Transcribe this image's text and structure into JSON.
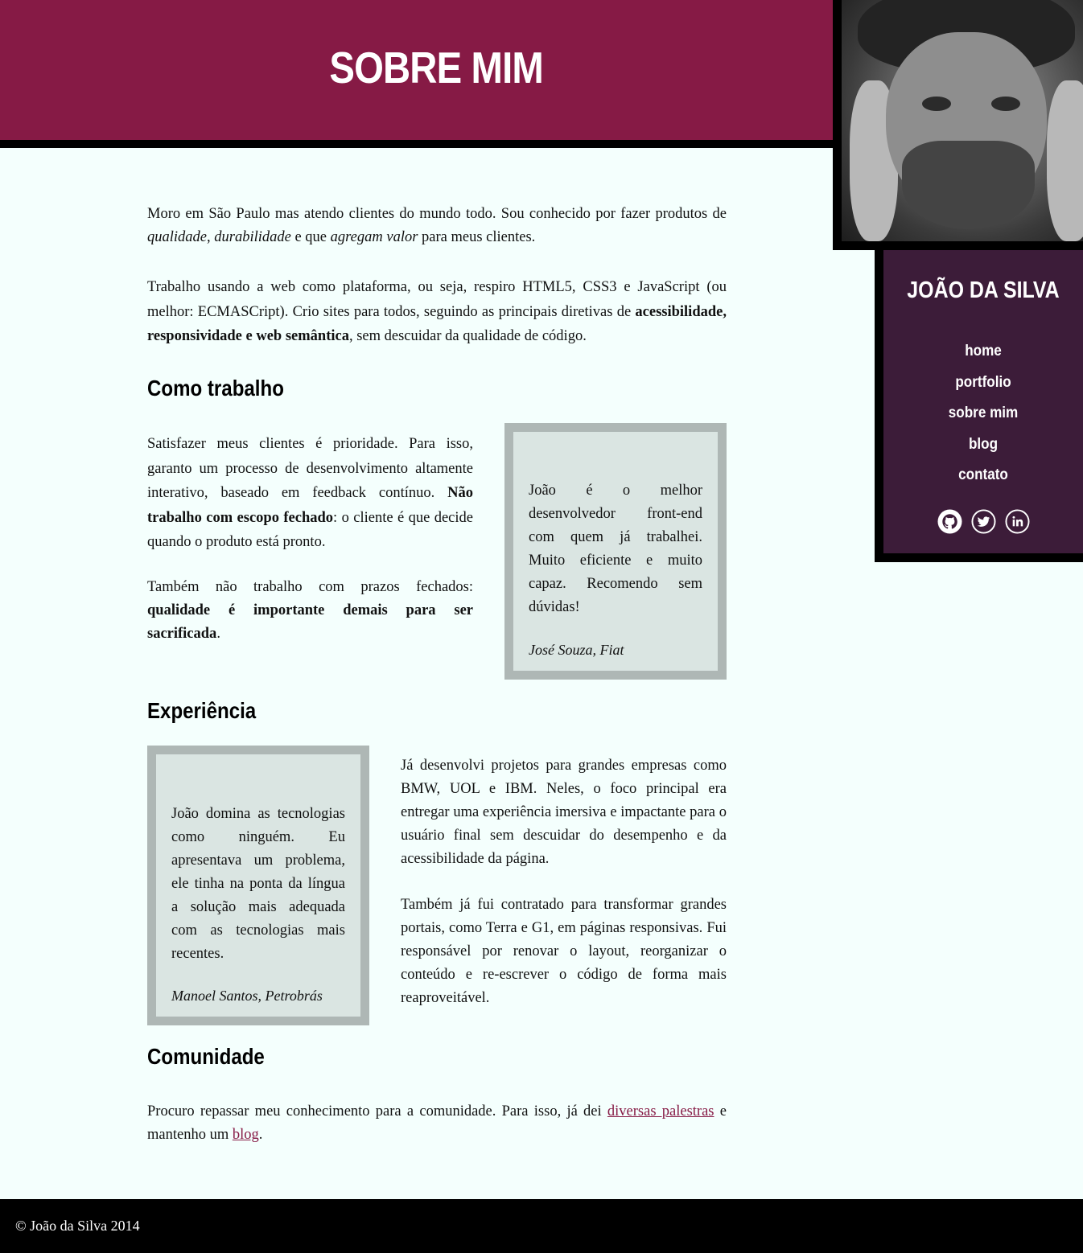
{
  "header": {
    "title": "SOBRE MIM"
  },
  "sidebar": {
    "site_name": "JOÃO DA SILVA",
    "nav": [
      "home",
      "portfolio",
      "sobre mim",
      "blog",
      "contato"
    ],
    "social_icons": [
      "github-icon",
      "twitter-icon",
      "linkedin-icon"
    ]
  },
  "intro": {
    "p1_a": "Moro em São Paulo mas atendo clientes do mundo todo. Sou conhecido por fazer produtos de ",
    "p1_em1": "qualidade",
    "p1_sep1": ", ",
    "p1_em2": "durabilidade",
    "p1_mid": " e que ",
    "p1_em3": "agregam valor",
    "p1_end": " para meus clientes.",
    "p2_a": "Trabalho usando a web como plataforma, ou seja, respiro HTML5, CSS3 e JavaScript (ou melhor: ECMASCript). Crio sites para todos, seguindo as principais diretivas de ",
    "p2_strong": "acessibilidade, responsividade e web semântica",
    "p2_end": ", sem descuidar da qualidade de código."
  },
  "como_trabalho": {
    "heading": "Como trabalho",
    "p1_a": "Satisfazer meus clientes é prioridade. Para isso, garanto um processo de desenvolvimento altamente interativo, baseado em feedback contínuo. ",
    "p1_strong": "Não trabalho com escopo fechado",
    "p1_end": ": o cliente é que decide quando o produto está pronto.",
    "p2_a": "Também não trabalho com prazos fechados: ",
    "p2_strong": "qualidade é importante demais para ser sacrificada",
    "p2_end": ".",
    "quote": {
      "text": "João é o melhor desenvolvedor front-end com quem já trabalhei. Muito eficiente e muito capaz. Recomendo sem dúvidas!",
      "author": "José Souza, Fiat"
    }
  },
  "experiencia": {
    "heading": "Experiência",
    "p1": "Já desenvolvi projetos para grandes empresas como BMW, UOL e IBM. Neles, o foco principal era entregar uma experiência imersiva e impactante para o usuário final sem descuidar do desempenho e da acessibilidade da página.",
    "p2": "Também já fui contratado para transformar grandes portais, como Terra e G1, em páginas responsivas. Fui responsável por renovar o layout, reorganizar o conteúdo e re-escrever o código de forma mais reaproveitável.",
    "quote": {
      "text": "João domina as tecnologias como ninguém. Eu apresentava um problema, ele tinha na ponta da língua a solução mais adequada com as tecnologias mais recentes.",
      "author": "Manoel Santos, Petrobrás"
    }
  },
  "comunidade": {
    "heading": "Comunidade",
    "text_a": "Procuro repassar meu conhecimento para a comunidade. Para isso, já dei ",
    "link1": "diversas palestras",
    "text_b": " e mantenho um ",
    "link2": "blog",
    "text_c": "."
  },
  "footer": {
    "copyright": "© João da Silva 2014"
  },
  "colors": {
    "accent": "#861a45",
    "sidebar": "#3c1c39",
    "quote_bg": "#dae5e2",
    "quote_border": "#aeb7b5",
    "background": "#f4fffd"
  }
}
